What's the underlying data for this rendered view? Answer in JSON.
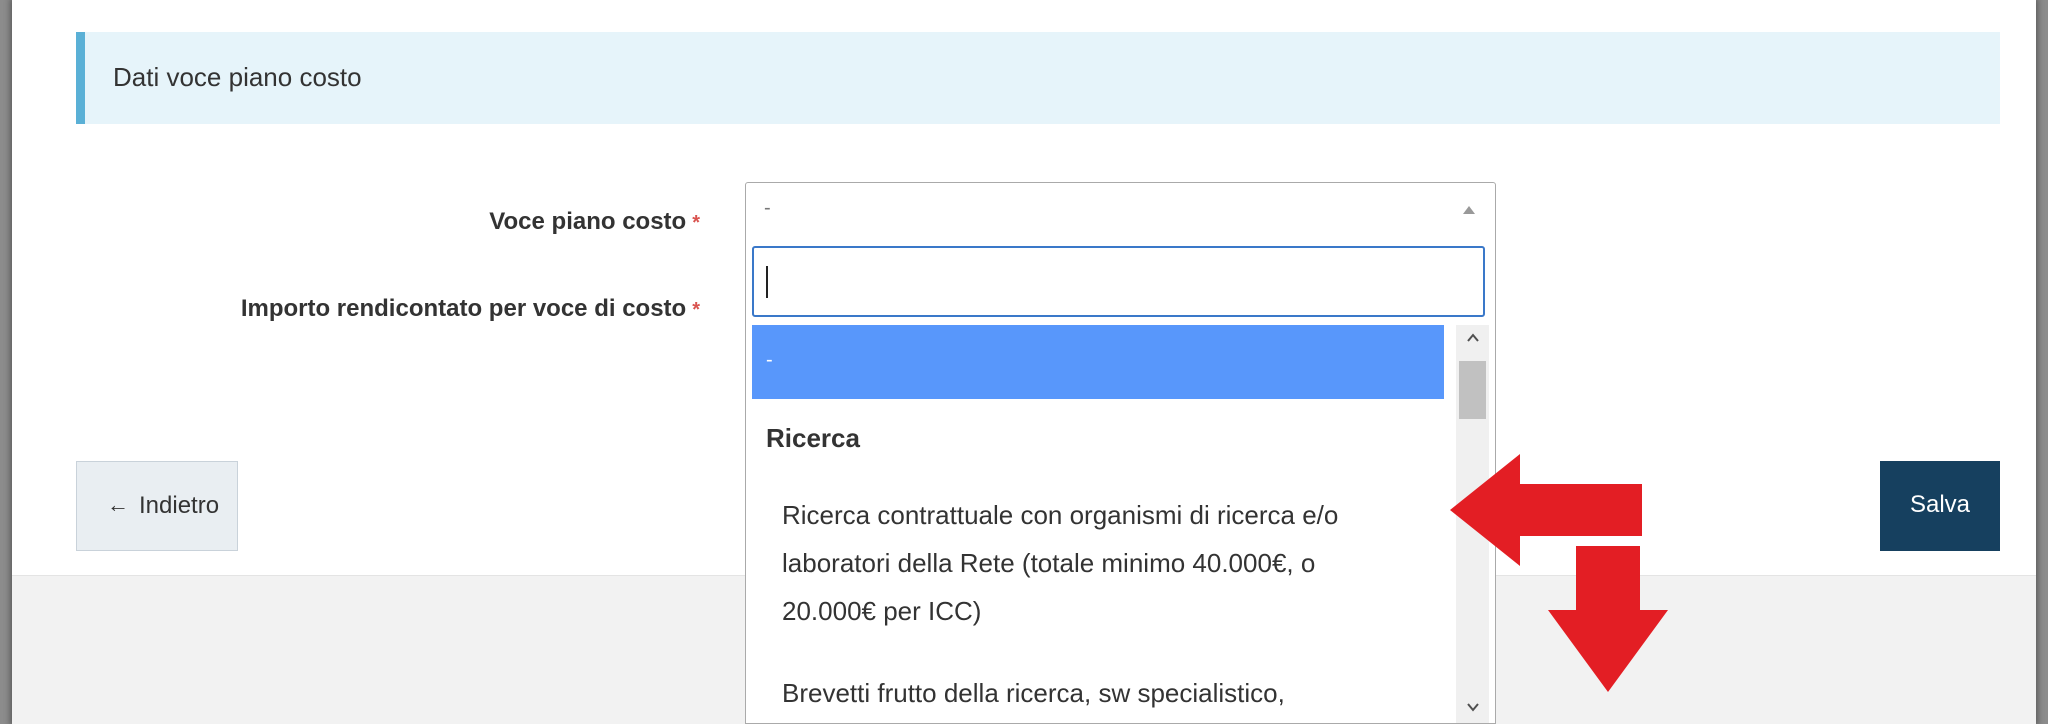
{
  "section": {
    "title": "Dati voce piano costo"
  },
  "form": {
    "voce_label": "Voce piano costo",
    "importo_label": "Importo rendicontato per voce di costo",
    "required_marker": "*",
    "select_value": "-"
  },
  "dropdown": {
    "search_value": "",
    "selected_option": "-",
    "group_label": "Ricerca",
    "options": [
      "Ricerca contrattuale con organismi di ricerca e/o laboratori della Rete (totale minimo 40.000€, o 20.000€ per ICC)",
      "Brevetti frutto della ricerca, sw specialistico,"
    ]
  },
  "buttons": {
    "back_label": "Indietro",
    "back_icon": "←",
    "save_label": "Salva"
  },
  "annotations": {
    "arrow_color": "#e31e24"
  },
  "colors": {
    "header_bg": "#e6f4fa",
    "header_accent": "#5ab0d6",
    "selected_option_bg": "#5897fb",
    "save_button_bg": "#16405f",
    "focus_border": "#3a78c9"
  }
}
